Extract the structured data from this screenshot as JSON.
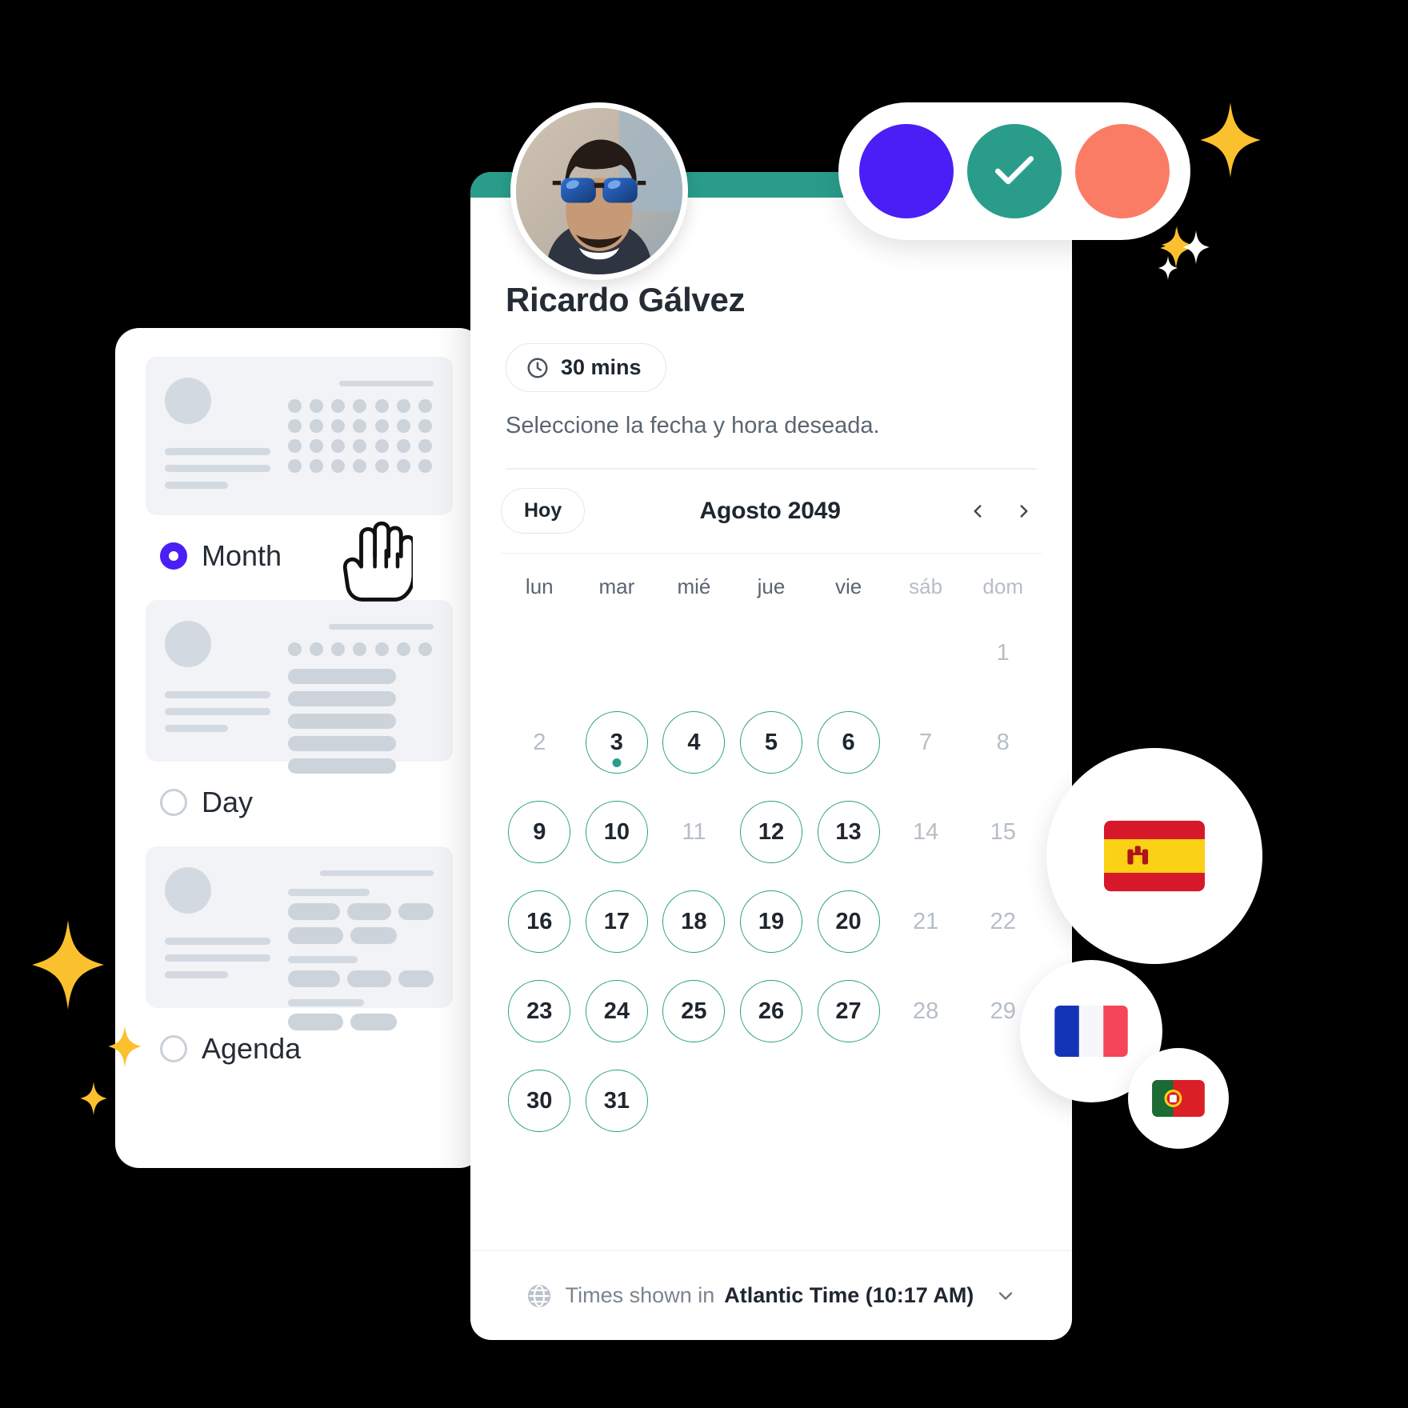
{
  "colors": {
    "teal": "#2a9d8a",
    "purple": "#4b1ef5",
    "coral": "#fa7c65",
    "dark_text": "#1f262e",
    "muted_text": "#7b848e",
    "disabled_text": "#b6bec7",
    "skeleton": "#d3d9e0",
    "sparkle_gold": "#fbc02d"
  },
  "color_picker": {
    "swatches": [
      {
        "name": "purple",
        "color": "#4b1ef5",
        "selected": false
      },
      {
        "name": "teal",
        "color": "#2a9d8a",
        "selected": true
      },
      {
        "name": "coral",
        "color": "#fa7c65",
        "selected": false
      }
    ]
  },
  "booking": {
    "host_name": "Ricardo Gálvez",
    "duration": "30 mins",
    "instruction": "Seleccione la fecha y hora deseada.",
    "avatar_alt": "avatar"
  },
  "calendar": {
    "today_label": "Hoy",
    "month_title": "Agosto 2049",
    "prev_label": "‹",
    "next_label": "›",
    "weekdays": [
      "lun",
      "mar",
      "mié",
      "jue",
      "vie",
      "sáb",
      "dom"
    ],
    "weekend_indices": [
      5,
      6
    ],
    "weeks": [
      [
        {
          "label": "",
          "state": "empty"
        },
        {
          "label": "",
          "state": "empty"
        },
        {
          "label": "",
          "state": "empty"
        },
        {
          "label": "",
          "state": "empty"
        },
        {
          "label": "",
          "state": "empty"
        },
        {
          "label": "",
          "state": "empty"
        },
        {
          "label": "1",
          "state": "disabled"
        }
      ],
      [
        {
          "label": "2",
          "state": "disabled"
        },
        {
          "label": "3",
          "state": "available",
          "today": true
        },
        {
          "label": "4",
          "state": "available"
        },
        {
          "label": "5",
          "state": "available"
        },
        {
          "label": "6",
          "state": "available"
        },
        {
          "label": "7",
          "state": "disabled"
        },
        {
          "label": "8",
          "state": "disabled"
        }
      ],
      [
        {
          "label": "9",
          "state": "available"
        },
        {
          "label": "10",
          "state": "available"
        },
        {
          "label": "11",
          "state": "disabled"
        },
        {
          "label": "12",
          "state": "available"
        },
        {
          "label": "13",
          "state": "available"
        },
        {
          "label": "14",
          "state": "disabled"
        },
        {
          "label": "15",
          "state": "disabled"
        }
      ],
      [
        {
          "label": "16",
          "state": "available"
        },
        {
          "label": "17",
          "state": "available"
        },
        {
          "label": "18",
          "state": "available"
        },
        {
          "label": "19",
          "state": "available"
        },
        {
          "label": "20",
          "state": "available"
        },
        {
          "label": "21",
          "state": "disabled"
        },
        {
          "label": "22",
          "state": "disabled"
        }
      ],
      [
        {
          "label": "23",
          "state": "available"
        },
        {
          "label": "24",
          "state": "available"
        },
        {
          "label": "25",
          "state": "available"
        },
        {
          "label": "26",
          "state": "available"
        },
        {
          "label": "27",
          "state": "available"
        },
        {
          "label": "28",
          "state": "disabled"
        },
        {
          "label": "29",
          "state": "disabled"
        }
      ],
      [
        {
          "label": "30",
          "state": "available"
        },
        {
          "label": "31",
          "state": "available"
        },
        {
          "label": "",
          "state": "empty"
        },
        {
          "label": "",
          "state": "empty"
        },
        {
          "label": "",
          "state": "empty"
        },
        {
          "label": "",
          "state": "empty"
        },
        {
          "label": "",
          "state": "empty"
        }
      ]
    ]
  },
  "footer": {
    "timezone_prefix": "Times shown in",
    "timezone_value": "Atlantic Time (10:17 AM)"
  },
  "view_selector": {
    "options": [
      {
        "label": "Month",
        "selected": true,
        "preview": "month"
      },
      {
        "label": "Day",
        "selected": false,
        "preview": "day"
      },
      {
        "label": "Agenda",
        "selected": false,
        "preview": "agenda"
      }
    ]
  },
  "locales": [
    {
      "name": "spain-flag",
      "country": "Spain"
    },
    {
      "name": "france-flag",
      "country": "France"
    },
    {
      "name": "portugal-flag",
      "country": "Portugal"
    }
  ]
}
